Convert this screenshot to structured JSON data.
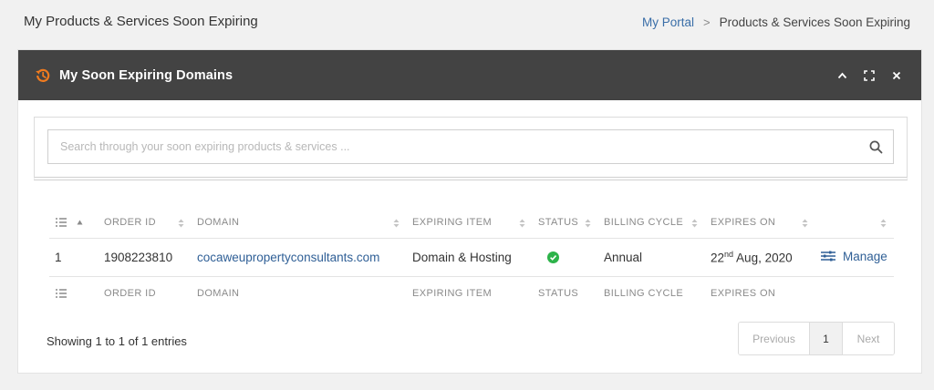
{
  "page": {
    "title": "My Products & Services Soon Expiring",
    "breadcrumb": {
      "link": "My Portal",
      "separator": ">",
      "current": "Products & Services Soon Expiring"
    }
  },
  "panel": {
    "title": "My Soon Expiring Domains",
    "tools": {
      "collapse": "^",
      "fullscreen": "[ ]",
      "close": "×"
    }
  },
  "search": {
    "placeholder": "Search through your soon expiring products & services ..."
  },
  "table": {
    "headers": [
      "ORDER ID",
      "DOMAIN",
      "EXPIRING ITEM",
      "STATUS",
      "BILLING CYCLE",
      "EXPIRES ON"
    ],
    "rows": [
      {
        "index": "1",
        "order_id": "1908223810",
        "domain": "cocaweupropertyconsultants.com",
        "expiring_item": "Domain & Hosting",
        "status": "active",
        "billing_cycle": "Annual",
        "expires_day": "22",
        "expires_suffix": "nd",
        "expires_rest": " Aug, 2020",
        "action": "Manage"
      }
    ],
    "footer": [
      "ORDER ID",
      "DOMAIN",
      "EXPIRING ITEM",
      "STATUS",
      "BILLING CYCLE",
      "EXPIRES ON"
    ]
  },
  "pagination": {
    "showing": "Showing 1 to 1 of 1 entries",
    "previous": "Previous",
    "current": "1",
    "next": "Next"
  },
  "colors": {
    "header_bg": "#434343",
    "accent_orange": "#f07b1f",
    "status_green": "#2db34a",
    "link_blue": "#2f5f96"
  },
  "icons": [
    "history-icon",
    "chevron-up-icon",
    "fullscreen-icon",
    "close-icon",
    "search-icon",
    "list-icon",
    "sort-icon",
    "check-circle-icon",
    "manage-sliders-icon"
  ]
}
